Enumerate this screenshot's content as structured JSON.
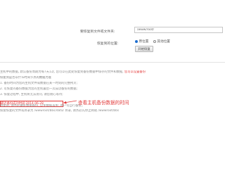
{
  "form": {
    "path_label": "要恢复到文件或文件夹:",
    "path_value": "/www/root/",
    "location_label": "恢复到的位置:",
    "radio_options": [
      "原位置",
      "其他位置"
    ],
    "selected_radio": "原位置",
    "restore_button": "开始恢复"
  },
  "notes": {
    "line1_a": "主机中的数据, 默认备份周期为每7天1次, 您可以在此处恢复到备份数据中保存的文件和数据, ",
    "line1_red": "您可以设置备份",
    "line2": "恢复到是否以什么时间节点的数据为准",
    "line3": "1. 备份时间为您的主机文件或数据在某一时刻的完整拷贝; ",
    "line4": "2. 可恢复的备份数据为您的主机最后一次成功备份的数据; ",
    "line5": "3. 恢复过程中, 主机将无法访问, 请您耐心等待; ",
    "backup_date_label": "最近备份成功时间:",
    "backup_date": "2014-06-28",
    "line7": "恢复前, 请务必做好数据备份, 以免数据丢失; 用户可自行备份。",
    "line8": "如需恢复的文件或目录为 /wwwroot/bbs/data/ 目录, 请务必先停止网站 /wwwroot/bbs"
  },
  "annotation": {
    "text": "查看主机备份数据的时间"
  },
  "colors": {
    "accent_red": "#e23b3b",
    "radio_blue": "#1f6fd0"
  }
}
